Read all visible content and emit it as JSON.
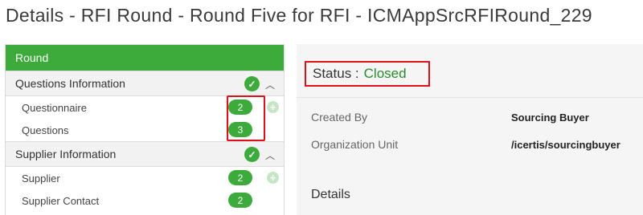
{
  "page": {
    "title": "Details - RFI Round - Round Five for RFI - ICMAppSrcRFIRound_229"
  },
  "left_panel": {
    "header": "Round",
    "sections": [
      {
        "label": "Questions Information",
        "items": [
          {
            "label": "Questionnaire",
            "count": "2",
            "addable": true
          },
          {
            "label": "Questions",
            "count": "3",
            "addable": false
          }
        ]
      },
      {
        "label": "Supplier Information",
        "items": [
          {
            "label": "Supplier",
            "count": "2",
            "addable": true
          },
          {
            "label": "Supplier Contact",
            "count": "2",
            "addable": false
          }
        ]
      }
    ]
  },
  "right_panel": {
    "status_label": "Status :",
    "status_value": "Closed",
    "fields": [
      {
        "label": "Created By",
        "value": "Sourcing Buyer"
      },
      {
        "label": "Organization Unit",
        "value": "/icertis/sourcingbuyer"
      }
    ],
    "details_heading": "Details"
  },
  "icons": {
    "check": "check-circle-icon",
    "collapse": "chevron-up-icon",
    "add": "plus-circle-icon"
  },
  "colors": {
    "accent_green": "#3cab3c",
    "status_green": "#2b8a2b",
    "highlight_red": "#e0101a"
  }
}
